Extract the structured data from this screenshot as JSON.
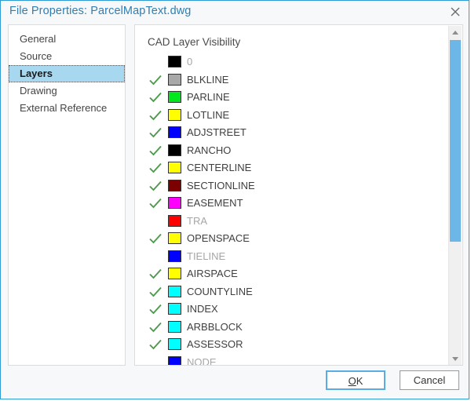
{
  "window": {
    "title": "File Properties: ParcelMapText.dwg",
    "close_icon": "close-icon",
    "border_color": "#2f9cd6",
    "title_color": "#2f7fb5"
  },
  "sidebar": {
    "items": [
      {
        "label": "General",
        "selected": false
      },
      {
        "label": "Source",
        "selected": false
      },
      {
        "label": "Layers",
        "selected": true
      },
      {
        "label": "Drawing",
        "selected": false
      },
      {
        "label": "External Reference",
        "selected": false
      }
    ],
    "selected_background": "#a8d8f0"
  },
  "main": {
    "heading": "CAD Layer Visibility",
    "check_color": "#4e9a4e",
    "layers": [
      {
        "name": "0",
        "visible": false,
        "color": "#000000"
      },
      {
        "name": "BLKLINE",
        "visible": true,
        "color": "#a8a8a8"
      },
      {
        "name": "PARLINE",
        "visible": true,
        "color": "#00e720"
      },
      {
        "name": "LOTLINE",
        "visible": true,
        "color": "#ffff00"
      },
      {
        "name": "ADJSTREET",
        "visible": true,
        "color": "#0000ff"
      },
      {
        "name": "RANCHO",
        "visible": true,
        "color": "#000000"
      },
      {
        "name": "CENTERLINE",
        "visible": true,
        "color": "#ffff00"
      },
      {
        "name": "SECTIONLINE",
        "visible": true,
        "color": "#7b0000"
      },
      {
        "name": "EASEMENT",
        "visible": true,
        "color": "#ff00ff"
      },
      {
        "name": "TRA",
        "visible": false,
        "color": "#ff0000"
      },
      {
        "name": "OPENSPACE",
        "visible": true,
        "color": "#ffff00"
      },
      {
        "name": "TIELINE",
        "visible": false,
        "color": "#0000ff"
      },
      {
        "name": "AIRSPACE",
        "visible": true,
        "color": "#ffff00"
      },
      {
        "name": "COUNTYLINE",
        "visible": true,
        "color": "#00ffff"
      },
      {
        "name": "INDEX",
        "visible": true,
        "color": "#00ffff"
      },
      {
        "name": "ARBBLOCK",
        "visible": true,
        "color": "#00ffff"
      },
      {
        "name": "ASSESSOR",
        "visible": true,
        "color": "#00ffff"
      },
      {
        "name": "NODE",
        "visible": false,
        "color": "#0000ff"
      }
    ]
  },
  "scrollbar": {
    "up_arrow_icon": "chevron-up-icon",
    "down_arrow_icon": "chevron-down-icon",
    "thumb_color": "#6cb6e8"
  },
  "footer": {
    "ok_label_prefix": "",
    "ok_mnemonic": "O",
    "ok_label_suffix": "K",
    "cancel_label": "Cancel"
  }
}
